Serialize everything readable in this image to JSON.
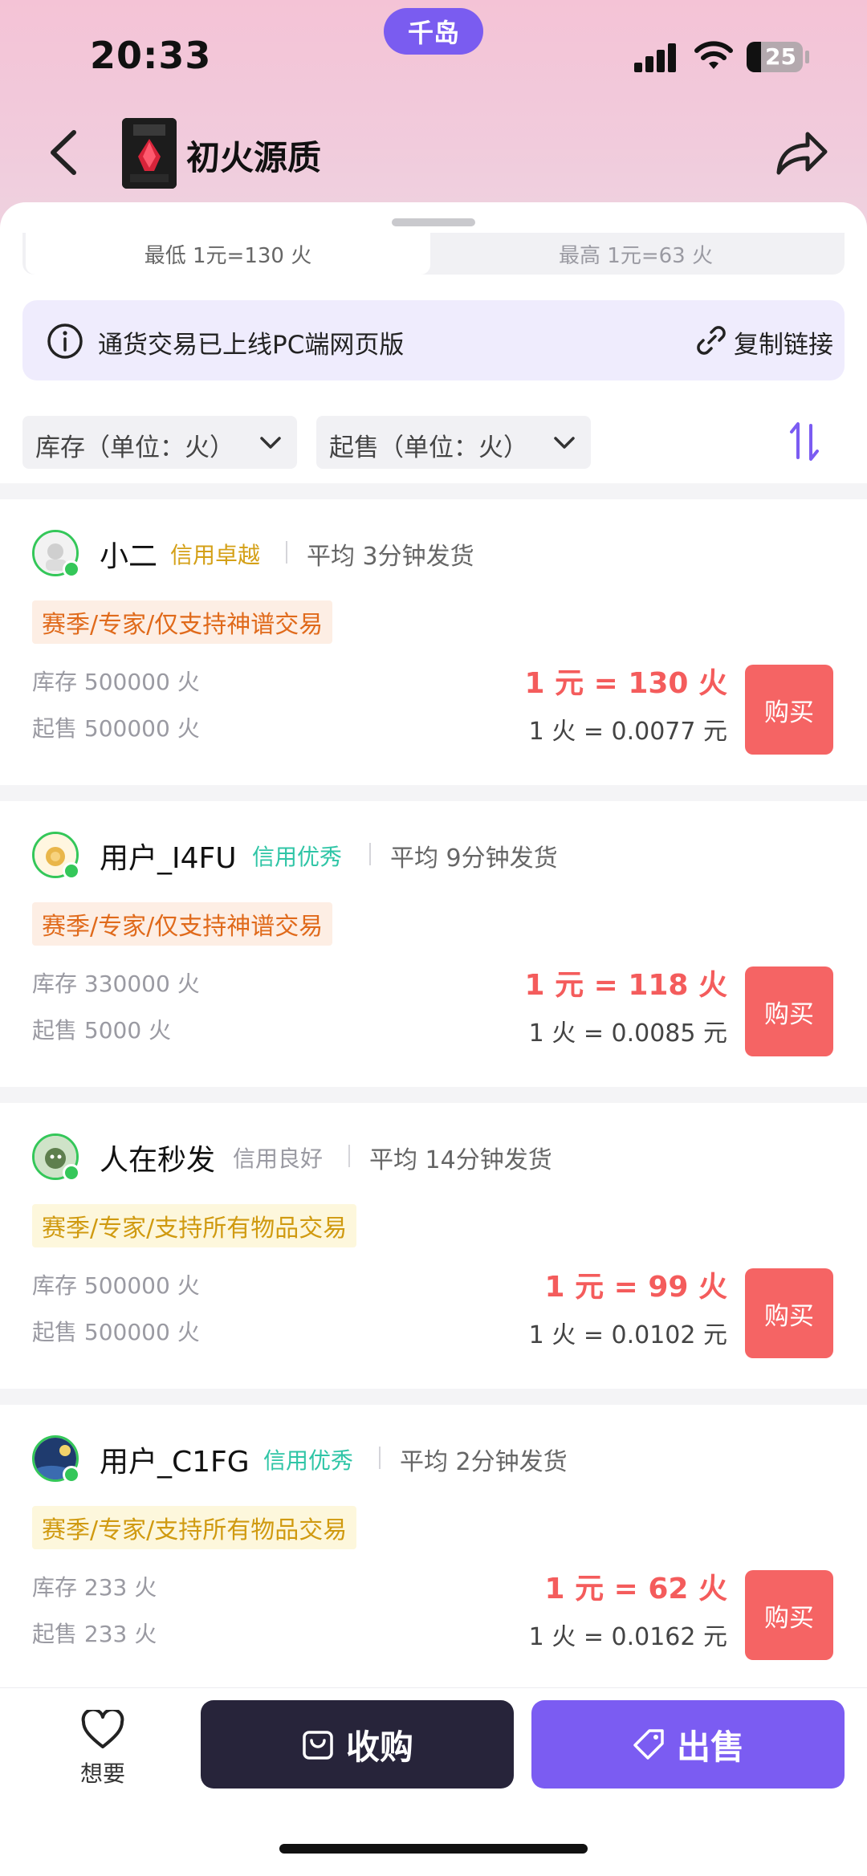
{
  "status_bar": {
    "time": "20:33",
    "island_label": "千岛",
    "battery": "25"
  },
  "nav": {
    "title": "初火源质",
    "icon_caption": "火焰之光"
  },
  "tabs": [
    {
      "label": "最低 1元=130 火"
    },
    {
      "label": "最高 1元=63 火"
    }
  ],
  "notice": {
    "text": "通货交易已上线PC端网页版",
    "copy_label": "复制链接"
  },
  "filters": {
    "stock_label": "库存（单位：火）",
    "min_label": "起售（单位：火）"
  },
  "sellers": [
    {
      "name": "小二",
      "credit": "信用卓越",
      "avg": "平均 3分钟发货",
      "tag": "赛季/专家/仅支持神谱交易",
      "stock": "库存 500000 火",
      "min": "起售 500000 火",
      "rate": "1 元 = 130 火",
      "unit": "1 火 = 0.0077 元",
      "buy": "购买"
    },
    {
      "name": "用户_I4FU",
      "credit": "信用优秀",
      "avg": "平均 9分钟发货",
      "tag": "赛季/专家/仅支持神谱交易",
      "stock": "库存 330000 火",
      "min": "起售 5000 火",
      "rate": "1 元 = 118 火",
      "unit": "1 火 = 0.0085 元",
      "buy": "购买"
    },
    {
      "name": "人在秒发",
      "credit": "信用良好",
      "avg": "平均 14分钟发货",
      "tag": "赛季/专家/支持所有物品交易",
      "stock": "库存 500000 火",
      "min": "起售 500000 火",
      "rate": "1 元 = 99 火",
      "unit": "1 火 = 0.0102 元",
      "buy": "购买"
    },
    {
      "name": "用户_C1FG",
      "credit": "信用优秀",
      "avg": "平均 2分钟发货",
      "tag": "赛季/专家/支持所有物品交易",
      "stock": "库存 233 火",
      "min": "起售 233 火",
      "rate": "1 元 = 62 火",
      "unit": "1 火 = 0.0162 元",
      "buy": "购买"
    }
  ],
  "bottom": {
    "want_label": "想要",
    "buyin_label": "收购",
    "sell_label": "出售"
  },
  "colors": {
    "accent": "#7b5cf2",
    "buy": "#f56464",
    "price": "#f45c5c",
    "online": "#34c759"
  }
}
